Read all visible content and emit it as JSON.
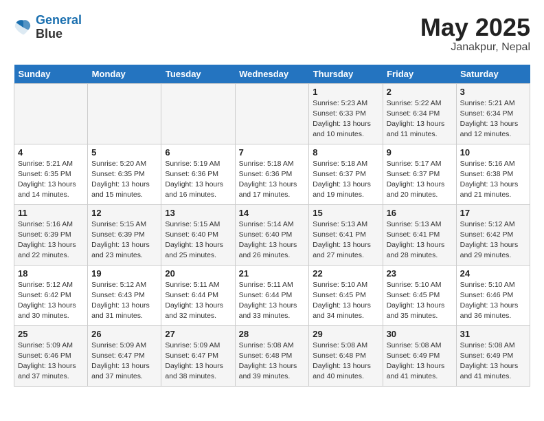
{
  "header": {
    "logo_line1": "General",
    "logo_line2": "Blue",
    "month": "May 2025",
    "location": "Janakpur, Nepal"
  },
  "weekdays": [
    "Sunday",
    "Monday",
    "Tuesday",
    "Wednesday",
    "Thursday",
    "Friday",
    "Saturday"
  ],
  "weeks": [
    [
      {
        "day": "",
        "info": ""
      },
      {
        "day": "",
        "info": ""
      },
      {
        "day": "",
        "info": ""
      },
      {
        "day": "",
        "info": ""
      },
      {
        "day": "1",
        "info": "Sunrise: 5:23 AM\nSunset: 6:33 PM\nDaylight: 13 hours\nand 10 minutes."
      },
      {
        "day": "2",
        "info": "Sunrise: 5:22 AM\nSunset: 6:34 PM\nDaylight: 13 hours\nand 11 minutes."
      },
      {
        "day": "3",
        "info": "Sunrise: 5:21 AM\nSunset: 6:34 PM\nDaylight: 13 hours\nand 12 minutes."
      }
    ],
    [
      {
        "day": "4",
        "info": "Sunrise: 5:21 AM\nSunset: 6:35 PM\nDaylight: 13 hours\nand 14 minutes."
      },
      {
        "day": "5",
        "info": "Sunrise: 5:20 AM\nSunset: 6:35 PM\nDaylight: 13 hours\nand 15 minutes."
      },
      {
        "day": "6",
        "info": "Sunrise: 5:19 AM\nSunset: 6:36 PM\nDaylight: 13 hours\nand 16 minutes."
      },
      {
        "day": "7",
        "info": "Sunrise: 5:18 AM\nSunset: 6:36 PM\nDaylight: 13 hours\nand 17 minutes."
      },
      {
        "day": "8",
        "info": "Sunrise: 5:18 AM\nSunset: 6:37 PM\nDaylight: 13 hours\nand 19 minutes."
      },
      {
        "day": "9",
        "info": "Sunrise: 5:17 AM\nSunset: 6:37 PM\nDaylight: 13 hours\nand 20 minutes."
      },
      {
        "day": "10",
        "info": "Sunrise: 5:16 AM\nSunset: 6:38 PM\nDaylight: 13 hours\nand 21 minutes."
      }
    ],
    [
      {
        "day": "11",
        "info": "Sunrise: 5:16 AM\nSunset: 6:39 PM\nDaylight: 13 hours\nand 22 minutes."
      },
      {
        "day": "12",
        "info": "Sunrise: 5:15 AM\nSunset: 6:39 PM\nDaylight: 13 hours\nand 23 minutes."
      },
      {
        "day": "13",
        "info": "Sunrise: 5:15 AM\nSunset: 6:40 PM\nDaylight: 13 hours\nand 25 minutes."
      },
      {
        "day": "14",
        "info": "Sunrise: 5:14 AM\nSunset: 6:40 PM\nDaylight: 13 hours\nand 26 minutes."
      },
      {
        "day": "15",
        "info": "Sunrise: 5:13 AM\nSunset: 6:41 PM\nDaylight: 13 hours\nand 27 minutes."
      },
      {
        "day": "16",
        "info": "Sunrise: 5:13 AM\nSunset: 6:41 PM\nDaylight: 13 hours\nand 28 minutes."
      },
      {
        "day": "17",
        "info": "Sunrise: 5:12 AM\nSunset: 6:42 PM\nDaylight: 13 hours\nand 29 minutes."
      }
    ],
    [
      {
        "day": "18",
        "info": "Sunrise: 5:12 AM\nSunset: 6:42 PM\nDaylight: 13 hours\nand 30 minutes."
      },
      {
        "day": "19",
        "info": "Sunrise: 5:12 AM\nSunset: 6:43 PM\nDaylight: 13 hours\nand 31 minutes."
      },
      {
        "day": "20",
        "info": "Sunrise: 5:11 AM\nSunset: 6:44 PM\nDaylight: 13 hours\nand 32 minutes."
      },
      {
        "day": "21",
        "info": "Sunrise: 5:11 AM\nSunset: 6:44 PM\nDaylight: 13 hours\nand 33 minutes."
      },
      {
        "day": "22",
        "info": "Sunrise: 5:10 AM\nSunset: 6:45 PM\nDaylight: 13 hours\nand 34 minutes."
      },
      {
        "day": "23",
        "info": "Sunrise: 5:10 AM\nSunset: 6:45 PM\nDaylight: 13 hours\nand 35 minutes."
      },
      {
        "day": "24",
        "info": "Sunrise: 5:10 AM\nSunset: 6:46 PM\nDaylight: 13 hours\nand 36 minutes."
      }
    ],
    [
      {
        "day": "25",
        "info": "Sunrise: 5:09 AM\nSunset: 6:46 PM\nDaylight: 13 hours\nand 37 minutes."
      },
      {
        "day": "26",
        "info": "Sunrise: 5:09 AM\nSunset: 6:47 PM\nDaylight: 13 hours\nand 37 minutes."
      },
      {
        "day": "27",
        "info": "Sunrise: 5:09 AM\nSunset: 6:47 PM\nDaylight: 13 hours\nand 38 minutes."
      },
      {
        "day": "28",
        "info": "Sunrise: 5:08 AM\nSunset: 6:48 PM\nDaylight: 13 hours\nand 39 minutes."
      },
      {
        "day": "29",
        "info": "Sunrise: 5:08 AM\nSunset: 6:48 PM\nDaylight: 13 hours\nand 40 minutes."
      },
      {
        "day": "30",
        "info": "Sunrise: 5:08 AM\nSunset: 6:49 PM\nDaylight: 13 hours\nand 41 minutes."
      },
      {
        "day": "31",
        "info": "Sunrise: 5:08 AM\nSunset: 6:49 PM\nDaylight: 13 hours\nand 41 minutes."
      }
    ]
  ]
}
